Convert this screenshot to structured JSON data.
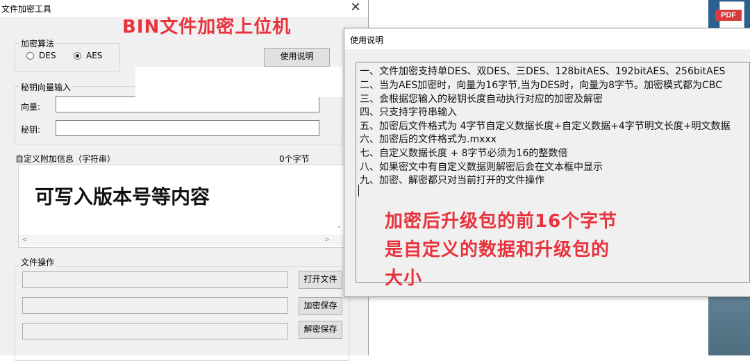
{
  "main_window": {
    "title": "文件加密工具",
    "close_glyph": "✕",
    "overlay_title": "BIN文件加密上位机"
  },
  "algorithm_group": {
    "label": "加密算法",
    "options": [
      "DES",
      "AES"
    ],
    "selected": "AES"
  },
  "help_button_label": "使用说明",
  "key_group": {
    "label": "秘钥向量输入",
    "vector_label": "向量:",
    "vector_value": "",
    "key_label": "秘钥:",
    "key_value": ""
  },
  "custom_info": {
    "label": "自定义附加信息（字符串）",
    "byte_count": "0个字节",
    "content": "可写入版本号等内容"
  },
  "file_group": {
    "label": "文件操作",
    "open_button": "打开文件",
    "encrypt_button": "加密保存",
    "decrypt_button": "解密保存"
  },
  "help_window": {
    "title": "使用说明",
    "lines": [
      "一、文件加密支持单DES、双DES、三DES、128bitAES、192bitAES、256bitAES",
      "二、当为AES加密时，向量为16字节,当为DES时，向量为8字节。加密模式都为CBC",
      "三、会根据您输入的秘钥长度自动执行对应的加密及解密",
      "四、只支持字符串输入",
      "五、加密后文件格式为 4字节自定义数据长度+自定义数据+4字节明文长度+明文数据",
      "六、加密后的文件格式为.mxxx",
      "七、自定义数据长度 + 8字节必须为16的整数倍",
      "八、如果密文中有自定义数据则解密后会在文本框中显示",
      "九、加密、解密都只对当前打开的文件操作"
    ],
    "red_note_lines": [
      "加密后升级包的前16个字节",
      "是自定义的数据和升级包的",
      "大小"
    ]
  },
  "desktop": {
    "pdf_icon_label": "PDF"
  },
  "colors": {
    "annotation_red": "#e8323c",
    "dialog_bg": "#f0f0f0"
  }
}
